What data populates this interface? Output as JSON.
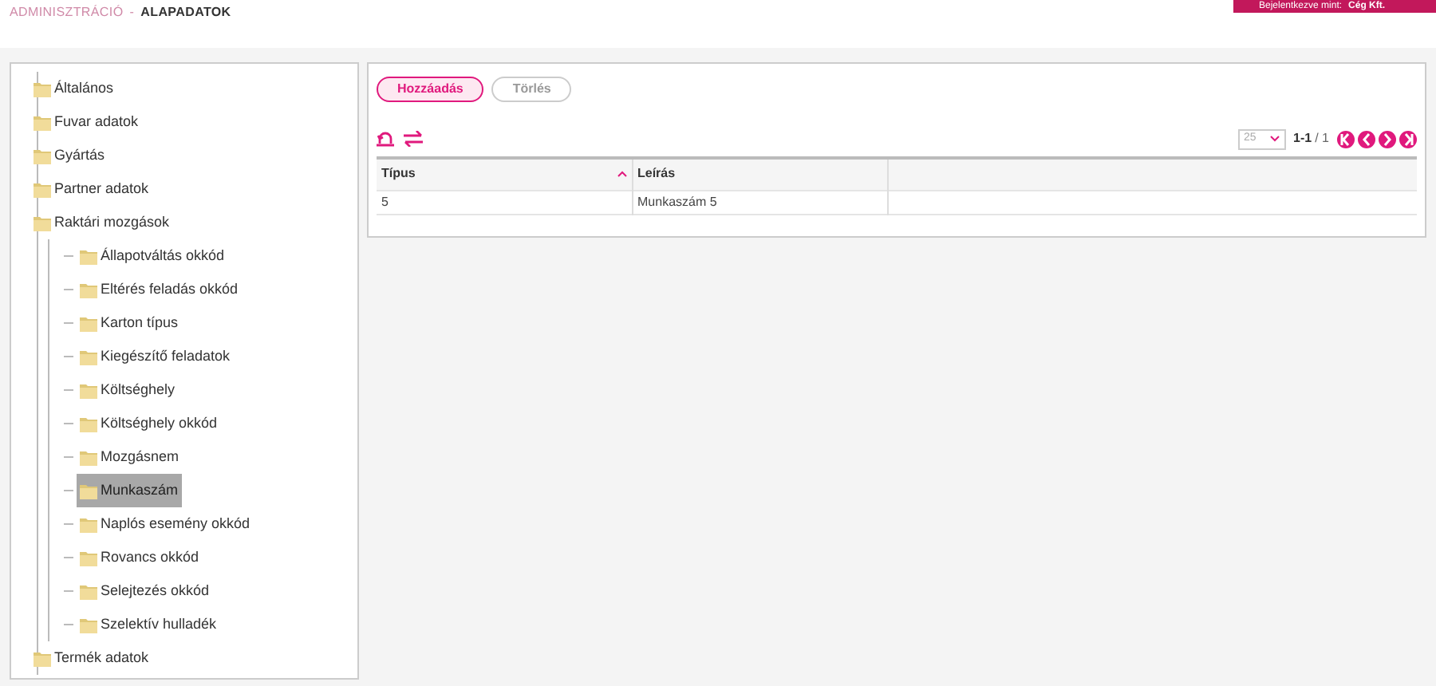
{
  "breadcrumb": {
    "parent": "ADMINISZTRÁCIÓ",
    "separator": "-",
    "current": "ALAPADATOK"
  },
  "user_bar": {
    "label": "Bejelentkezve mint:",
    "name": "Cég Kft."
  },
  "tree": [
    {
      "label": "Általános",
      "selected": false
    },
    {
      "label": "Fuvar adatok",
      "selected": false
    },
    {
      "label": "Gyártás",
      "selected": false
    },
    {
      "label": "Partner adatok",
      "selected": false
    },
    {
      "label": "Raktári mozgások",
      "selected": false,
      "children": [
        {
          "label": "Állapotváltás okkód",
          "selected": false
        },
        {
          "label": "Eltérés feladás okkód",
          "selected": false
        },
        {
          "label": "Karton típus",
          "selected": false
        },
        {
          "label": "Kiegészítő feladatok",
          "selected": false
        },
        {
          "label": "Költséghely",
          "selected": false
        },
        {
          "label": "Költséghely okkód",
          "selected": false
        },
        {
          "label": "Mozgásnem",
          "selected": false
        },
        {
          "label": "Munkaszám",
          "selected": true
        },
        {
          "label": "Naplós esemény okkód",
          "selected": false
        },
        {
          "label": "Rovancs okkód",
          "selected": false
        },
        {
          "label": "Selejtezés okkód",
          "selected": false
        },
        {
          "label": "Szelektív hulladék",
          "selected": false
        }
      ]
    },
    {
      "label": "Termék adatok",
      "selected": false
    }
  ],
  "actions": [
    {
      "label": "Hozzáadás",
      "disabled": false
    },
    {
      "label": "Törlés",
      "disabled": true
    }
  ],
  "pagination": {
    "page_size": "25",
    "range": "1-1",
    "total": "/ 1"
  },
  "table": {
    "columns": [
      {
        "label": "Típus",
        "sorted": true
      },
      {
        "label": "Leírás",
        "sorted": false
      }
    ],
    "rows": [
      [
        "5",
        "Munkaszám 5"
      ]
    ]
  }
}
